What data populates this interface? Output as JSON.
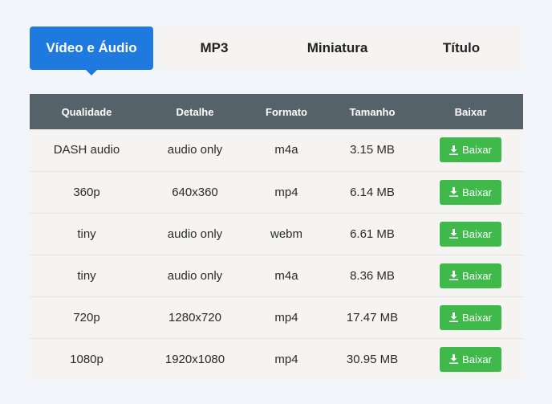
{
  "tabs": [
    {
      "label": "Vídeo e Áudio",
      "active": true
    },
    {
      "label": "MP3",
      "active": false
    },
    {
      "label": "Miniatura",
      "active": false
    },
    {
      "label": "Título",
      "active": false
    }
  ],
  "table": {
    "headers": [
      "Qualidade",
      "Detalhe",
      "Formato",
      "Tamanho",
      "Baixar"
    ],
    "rows": [
      {
        "quality": "DASH audio",
        "detail": "audio only",
        "format": "m4a",
        "size": "3.15 MB",
        "button": "Baixar"
      },
      {
        "quality": "360p",
        "detail": "640x360",
        "format": "mp4",
        "size": "6.14 MB",
        "button": "Baixar"
      },
      {
        "quality": "tiny",
        "detail": "audio only",
        "format": "webm",
        "size": "6.61 MB",
        "button": "Baixar"
      },
      {
        "quality": "tiny",
        "detail": "audio only",
        "format": "m4a",
        "size": "8.36 MB",
        "button": "Baixar"
      },
      {
        "quality": "720p",
        "detail": "1280x720",
        "format": "mp4",
        "size": "17.47 MB",
        "button": "Baixar"
      },
      {
        "quality": "1080p",
        "detail": "1920x1080",
        "format": "mp4",
        "size": "30.95 MB",
        "button": "Baixar"
      }
    ]
  },
  "icons": {
    "download": "download-icon"
  },
  "colors": {
    "accent": "#1f7ae0",
    "header": "#56626a",
    "download": "#3fb94a",
    "row_bg": "#f5f4f3"
  }
}
